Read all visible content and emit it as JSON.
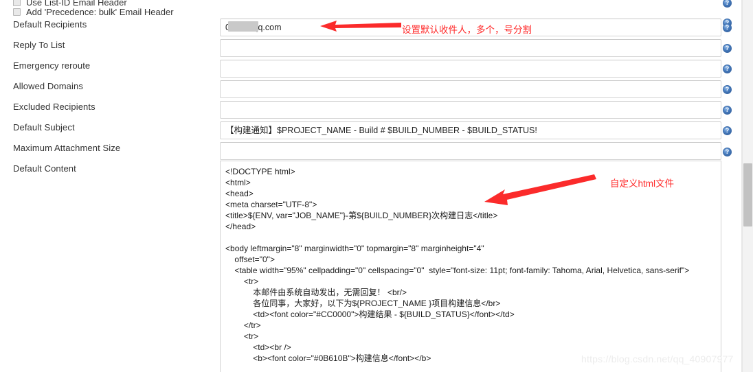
{
  "window": {
    "watermark": "https://blog.csdn.net/qq_40907977"
  },
  "checkboxes": [
    {
      "label": "Use List-ID Email Header",
      "checked": false
    },
    {
      "label": "Add 'Precedence: bulk' Email Header",
      "checked": false
    }
  ],
  "fields": [
    {
      "label": "Default Recipients",
      "value": "0086@qq.com",
      "redacted": true
    },
    {
      "label": "Reply To List",
      "value": "",
      "redacted": false
    },
    {
      "label": "Emergency reroute",
      "value": "",
      "redacted": false
    },
    {
      "label": "Allowed Domains",
      "value": "",
      "redacted": false
    },
    {
      "label": "Excluded Recipients",
      "value": "",
      "redacted": false
    },
    {
      "label": "Default Subject",
      "value": "【构建通知】$PROJECT_NAME - Build # $BUILD_NUMBER - $BUILD_STATUS!",
      "redacted": false
    },
    {
      "label": "Maximum Attachment Size",
      "value": "",
      "redacted": false
    }
  ],
  "content_field": {
    "label": "Default Content",
    "value": "<!DOCTYPE html>\n<html>\n<head>\n<meta charset=\"UTF-8\">\n<title>${ENV, var=\"JOB_NAME\"}-第${BUILD_NUMBER}次构建日志</title>\n</head>\n\n<body leftmargin=\"8\" marginwidth=\"0\" topmargin=\"8\" marginheight=\"4\"\n    offset=\"0\">\n    <table width=\"95%\" cellpadding=\"0\" cellspacing=\"0\"  style=\"font-size: 11pt; font-family: Tahoma, Arial, Helvetica, sans-serif\">\n        <tr>\n            本邮件由系统自动发出，无需回复！ <br/>\n            各位同事，大家好，以下为${PROJECT_NAME }项目构建信息</br>\n            <td><font color=\"#CC0000\">构建结果 - ${BUILD_STATUS}</font></td>\n        </tr>\n        <tr>\n            <td><br />\n            <b><font color=\"#0B610B\">构建信息</font></b>"
  },
  "help_icons": {
    "glyph": "?",
    "name": "help-icon",
    "count": 9
  },
  "annotations": [
    {
      "name": "default-recipients-annotation",
      "text": "设置默认收件人，多个，号分割",
      "color": "#ff2a2a"
    },
    {
      "name": "default-content-annotation",
      "text": "自定义html文件",
      "color": "#ff2a2a"
    }
  ],
  "colors": {
    "annotation_red": "#ff2a2a",
    "help_icon_blue": "#2d5896",
    "field_border": "#d4d4d4",
    "text": "#333333"
  }
}
